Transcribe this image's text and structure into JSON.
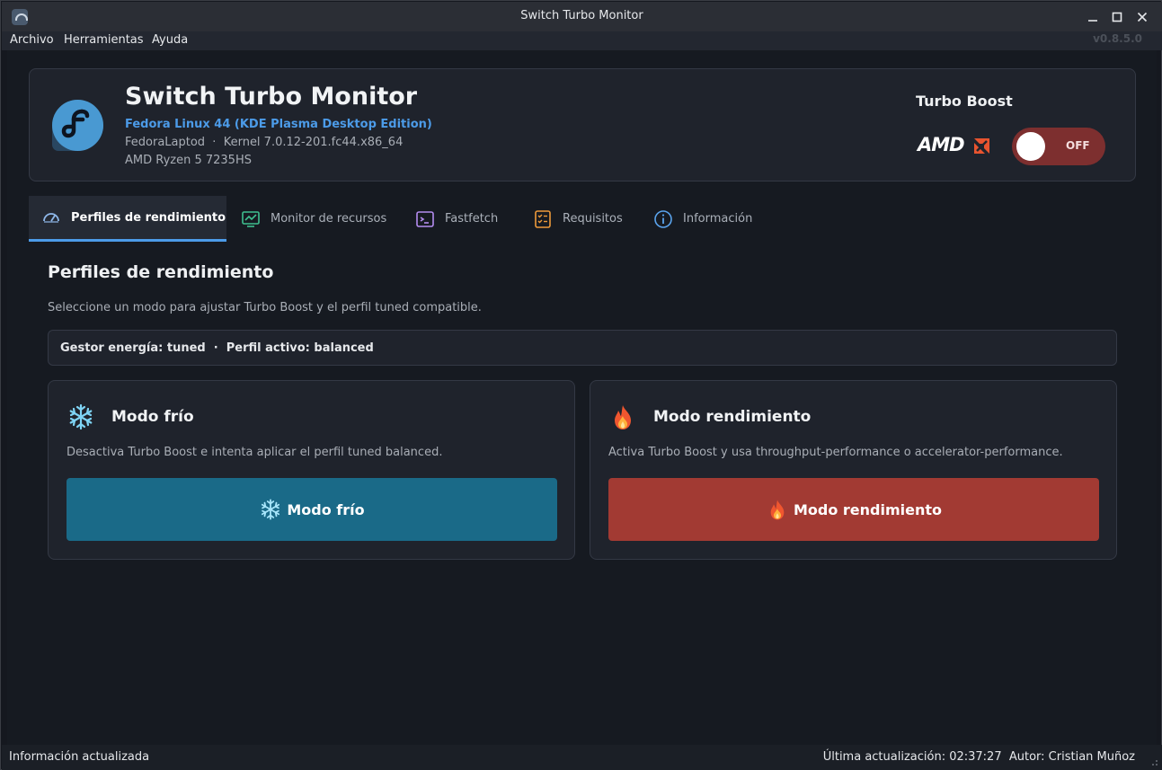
{
  "window": {
    "title": "Switch Turbo Monitor",
    "minimize": "–",
    "maximize": "□",
    "close": "✕"
  },
  "menu": {
    "items": [
      "Archivo",
      "Herramientas",
      "Ayuda"
    ],
    "version": "v0.8.5.0"
  },
  "header": {
    "app_title": "Switch Turbo Monitor",
    "os": "Fedora Linux 44 (KDE Plasma Desktop Edition)",
    "host_kernel": "FedoraLaptod  ·  Kernel 7.0.12-201.fc44.x86_64",
    "cpu": "AMD Ryzen 5 7235HS",
    "turbo_label": "Turbo Boost",
    "brand": "AMD",
    "toggle_state": "OFF",
    "colors": {
      "accent": "#4c9be8",
      "toggle_off": "#7d2f2f",
      "brand_arrow": "#e8542f"
    }
  },
  "tabs": [
    {
      "label": "Perfiles de rendimiento",
      "icon": "gauge-icon",
      "active": true
    },
    {
      "label": "Monitor de recursos",
      "icon": "chart-icon",
      "active": false
    },
    {
      "label": "Fastfetch",
      "icon": "terminal-icon",
      "active": false
    },
    {
      "label": "Requisitos",
      "icon": "checklist-icon",
      "active": false
    },
    {
      "label": "Información",
      "icon": "info-icon",
      "active": false
    }
  ],
  "profiles": {
    "title": "Perfiles de rendimiento",
    "description": "Seleccione un modo para ajustar Turbo Boost y el perfil tuned compatible.",
    "status": "Gestor energía: tuned  ·  Perfil activo: balanced"
  },
  "modes": {
    "cold": {
      "title": "Modo frío",
      "description": "Desactiva Turbo Boost e intenta aplicar el perfil tuned balanced.",
      "button": "Modo frío",
      "icon": "snowflake-icon",
      "color": "#1a6a88"
    },
    "performance": {
      "title": "Modo rendimiento",
      "description": "Activa Turbo Boost y usa throughput-performance o accelerator-performance.",
      "button": "Modo rendimiento",
      "icon": "fire-icon",
      "color": "#a23a33"
    }
  },
  "status_bar": {
    "left": "Información actualizada",
    "right": "Última actualización: 02:37:27  Autor: Cristian Muñoz"
  }
}
